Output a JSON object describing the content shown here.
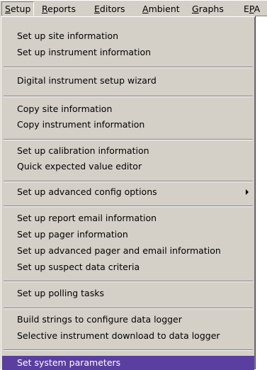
{
  "menubar": {
    "items": [
      {
        "mnemonic": "S",
        "rest": "etup"
      },
      {
        "mnemonic": "R",
        "rest": "eports"
      },
      {
        "mnemonic": "E",
        "rest": "ditors"
      },
      {
        "mnemonic": "A",
        "rest": "mbient"
      },
      {
        "mnemonic": "G",
        "rest": "raphs"
      },
      {
        "pre": "E",
        "mnemonic": "P",
        "rest": "A"
      }
    ]
  },
  "setup_menu": {
    "items": [
      "Set up site information",
      "Set up instrument information",
      "Digital instrument setup wizard",
      "Copy site information",
      "Copy instrument information",
      "Set up calibration information",
      "Quick expected value editor",
      "Set up advanced config options",
      "Set up report email information",
      "Set up pager information",
      "Set up advanced pager and email information",
      "Set up suspect data criteria",
      "Set up polling tasks",
      "Build strings to configure data logger",
      "Selective instrument download to data logger",
      "Set system parameters"
    ],
    "highlight_color": "#5a3fa0"
  }
}
